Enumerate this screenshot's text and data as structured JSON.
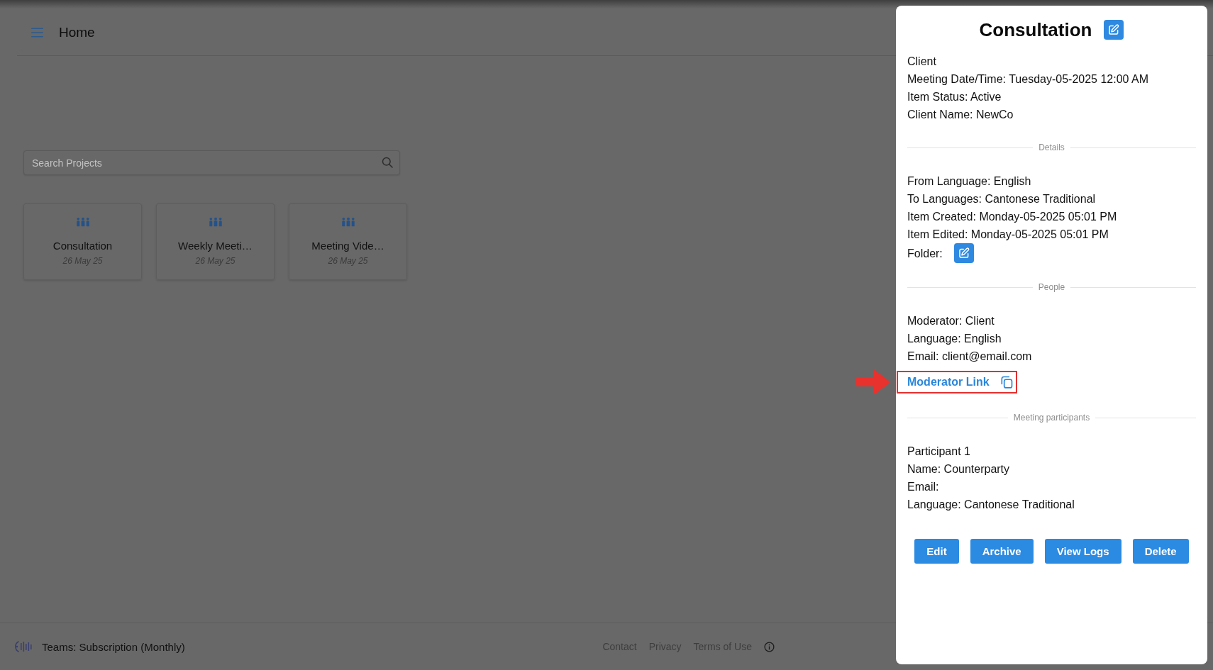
{
  "header": {
    "title": "Home"
  },
  "search": {
    "placeholder": "Search Projects"
  },
  "projects": [
    {
      "title": "Consultation",
      "date": "26 May 25"
    },
    {
      "title": "Weekly Meeti…",
      "date": "26 May 25"
    },
    {
      "title": "Meeting Vide…",
      "date": "26 May 25"
    }
  ],
  "footer": {
    "plan": "Teams: Subscription (Monthly)",
    "links": [
      "Contact",
      "Privacy",
      "Terms of Use"
    ]
  },
  "panel": {
    "title": "Consultation",
    "sections": [
      {
        "items": [
          {
            "kind": "text",
            "text": "Client"
          },
          {
            "kind": "text",
            "text": "Meeting Date/Time: Tuesday-05-2025 12:00 AM"
          },
          {
            "kind": "text",
            "text": "Item Status: Active"
          },
          {
            "kind": "text",
            "text": "Client Name: NewCo"
          }
        ]
      },
      {
        "heading": "Details",
        "items": [
          {
            "kind": "text",
            "text": "From Language: English"
          },
          {
            "kind": "text",
            "text": "To Languages: Cantonese Traditional"
          },
          {
            "kind": "text",
            "text": "Item Created: Monday-05-2025 05:01 PM"
          },
          {
            "kind": "text",
            "text": "Item Edited: Monday-05-2025 05:01 PM"
          },
          {
            "kind": "edit",
            "text": "Folder:"
          }
        ]
      },
      {
        "heading": "People",
        "items": [
          {
            "kind": "text",
            "text": "Moderator: Client"
          },
          {
            "kind": "text",
            "text": "Language: English"
          },
          {
            "kind": "text",
            "text": "Email: client@email.com"
          },
          {
            "kind": "link",
            "text": "Moderator Link",
            "highlighted": true
          }
        ]
      },
      {
        "heading": "Meeting participants",
        "items": [
          {
            "kind": "text",
            "text": "Participant 1"
          },
          {
            "kind": "text",
            "text": "Name: Counterparty"
          },
          {
            "kind": "text",
            "text": "Email:"
          },
          {
            "kind": "text",
            "text": "Language: Cantonese Traditional"
          }
        ]
      }
    ],
    "buttons": [
      "Edit",
      "Archive",
      "View Logs",
      "Delete"
    ]
  }
}
